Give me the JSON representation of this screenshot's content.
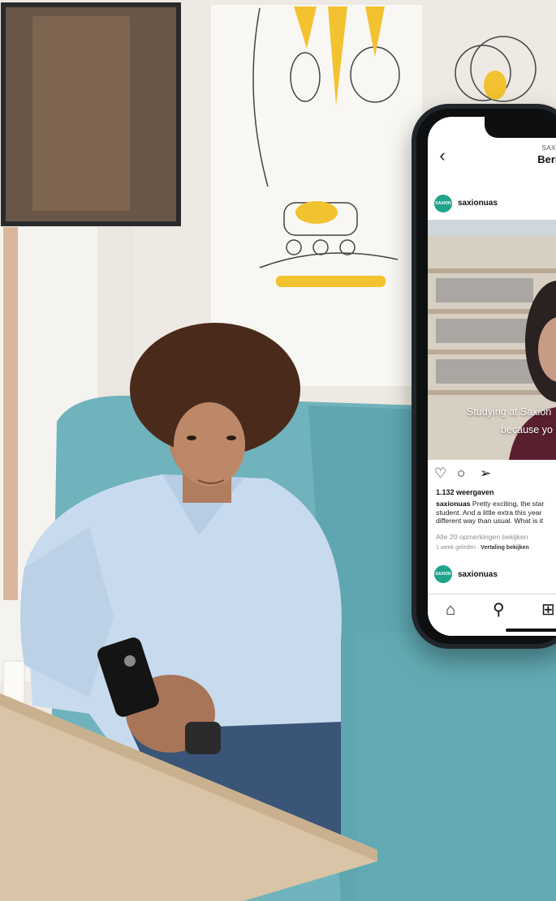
{
  "instagram": {
    "header": {
      "back_icon": "chevron-left-icon",
      "account": "SAXIONU",
      "title": "Bericht"
    },
    "post": {
      "avatar_text": "SAXION",
      "username": "saxionuas",
      "video_subtitle_line1": "Studying at Saxion",
      "video_subtitle_line2": "because yo",
      "action_icons": [
        "heart-icon",
        "comment-icon",
        "share-icon"
      ],
      "views": "1.132 weergaven",
      "caption_user": "saxionuas",
      "caption_line1": "Pretty exciting, the star",
      "caption_line2": "student. And a little extra this year",
      "caption_line3": "different way than usual. What is it",
      "comments_link": "Alle 20 opmerkingen bekijken",
      "time_ago": "1 week geleden",
      "separator": "·",
      "translate_link": "Vertaling bekijken"
    },
    "next_post": {
      "avatar_text": "SAXION",
      "username": "saxionuas"
    },
    "bottom_nav": [
      "home-icon",
      "search-icon",
      "new-post-icon"
    ]
  },
  "colors": {
    "brand_green": "#1fa38a",
    "sofa_teal": "#6fb1ba",
    "shirt_blue": "#c9dcef",
    "table_wood": "#d8c3a6"
  }
}
